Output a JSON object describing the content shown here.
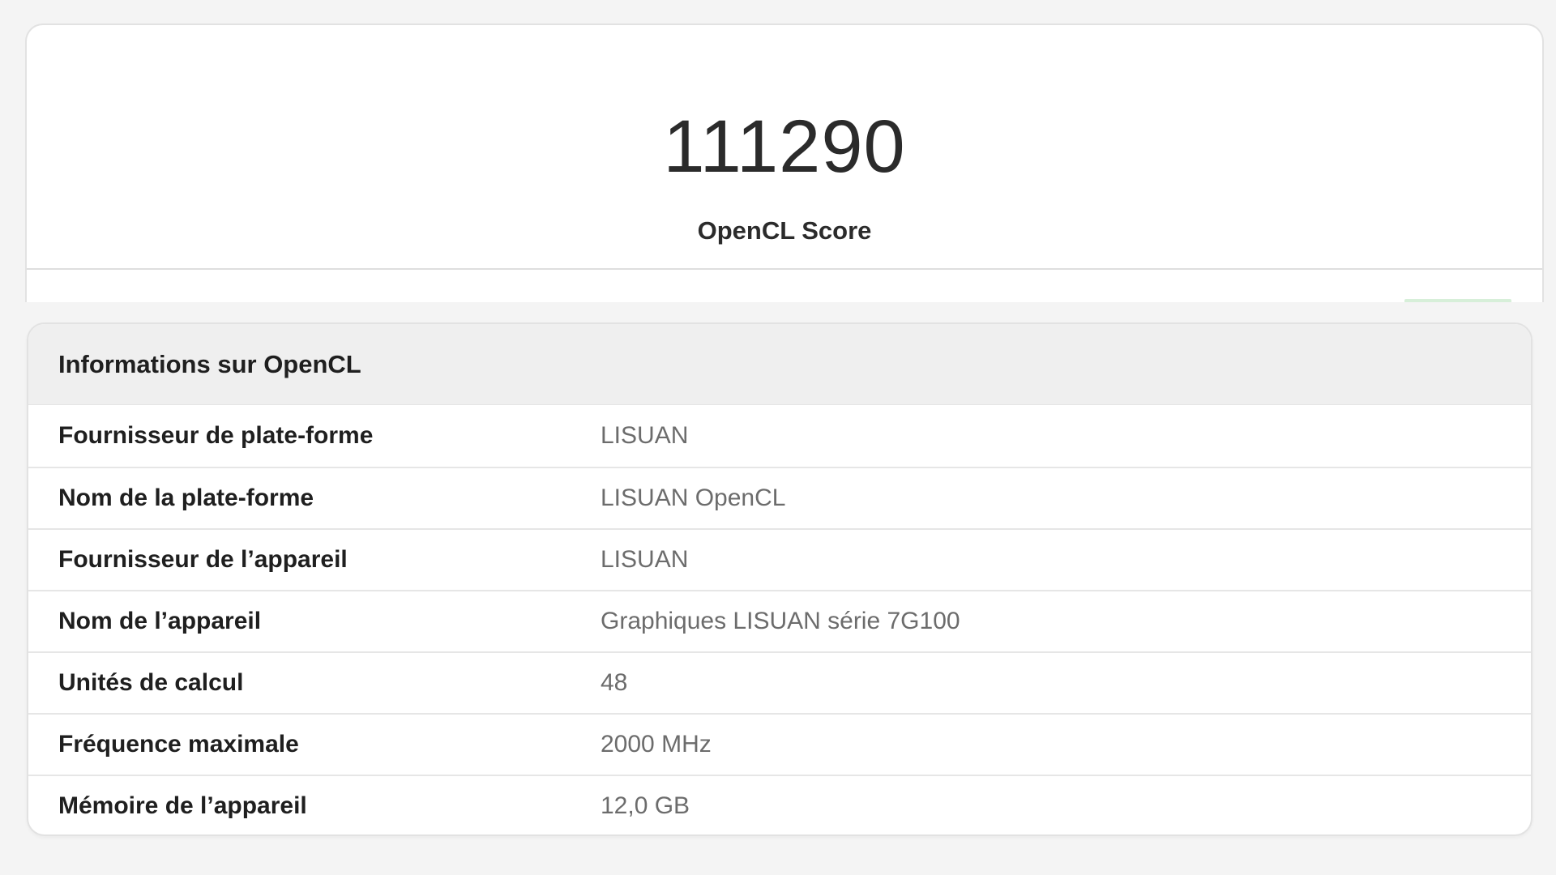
{
  "score": {
    "value": "111290",
    "label": "OpenCL Score"
  },
  "info": {
    "title": "Informations sur OpenCL",
    "rows": [
      {
        "label": "Fournisseur de plate-forme",
        "value": "LISUAN"
      },
      {
        "label": "Nom de la plate-forme",
        "value": "LISUAN OpenCL"
      },
      {
        "label": "Fournisseur de l’appareil",
        "value": "LISUAN"
      },
      {
        "label": "Nom de l’appareil",
        "value": "Graphiques LISUAN série 7G100"
      },
      {
        "label": "Unités de calcul",
        "value": "48"
      },
      {
        "label": "Fréquence maximale",
        "value": "2000 MHz"
      },
      {
        "label": "Mémoire de l’appareil",
        "value": "12,0 GB"
      }
    ]
  },
  "colors": {
    "background": "#f4f4f4",
    "card": "#ffffff",
    "header_bg": "#efefef",
    "value_text": "#6c6c6c",
    "accent_green": "#d7efd9"
  }
}
